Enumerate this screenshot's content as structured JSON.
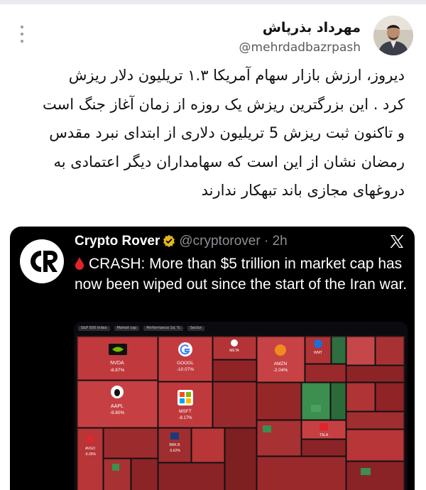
{
  "post": {
    "author_name": "مهرداد بذرپاش",
    "author_handle": "@mehrdadbazrpash",
    "body_lines": [
      "دیروز، ارزش بازار سهام آمریکا ۱.۳ تریلیون دلار ریزش",
      "کرد . این بزرگترین ریزش یک روزه از زمان آغاز جنگ است",
      "و تاکنون ثبت ریزش 5 تریلیون دلاری از ابتدای نبرد مقدس",
      "رمضان نشان از این است که سهامداران دیگر اعتمادی به",
      "دروغهای مجازی باند تبهکار ندارند"
    ]
  },
  "quoted": {
    "name": "Crypto Rover",
    "handle": "@cryptorover",
    "time": "· 2h",
    "text": "CRASH: More than $5 trillion in market cap has now been wiped out since the start of the Iran war.",
    "tabs": [
      "S&P 500 Index",
      "Market cap",
      "Performance 1d, %",
      "Sector"
    ],
    "tiles": [
      {
        "ticker": "NVDA",
        "change": "-8.87%"
      },
      {
        "ticker": "GOOGL",
        "change": "-10.07%"
      },
      {
        "ticker": "META",
        "change": ""
      },
      {
        "ticker": "AMZN",
        "change": "-2.04%"
      },
      {
        "ticker": "WMT",
        "change": ""
      },
      {
        "ticker": "AAPL",
        "change": "-9.80%"
      },
      {
        "ticker": "MSFT",
        "change": "-8.17%"
      },
      {
        "ticker": "AVGO",
        "change": "-9.36%"
      },
      {
        "ticker": "BRK.B",
        "change": "-5.62%"
      },
      {
        "ticker": "TSLA",
        "change": ""
      }
    ]
  },
  "colors": {
    "red_dark": "#8f2326",
    "red": "#b8373a",
    "red_light": "#d9585c",
    "green": "#3c8f4f",
    "accent_verified": "#e2b719"
  }
}
